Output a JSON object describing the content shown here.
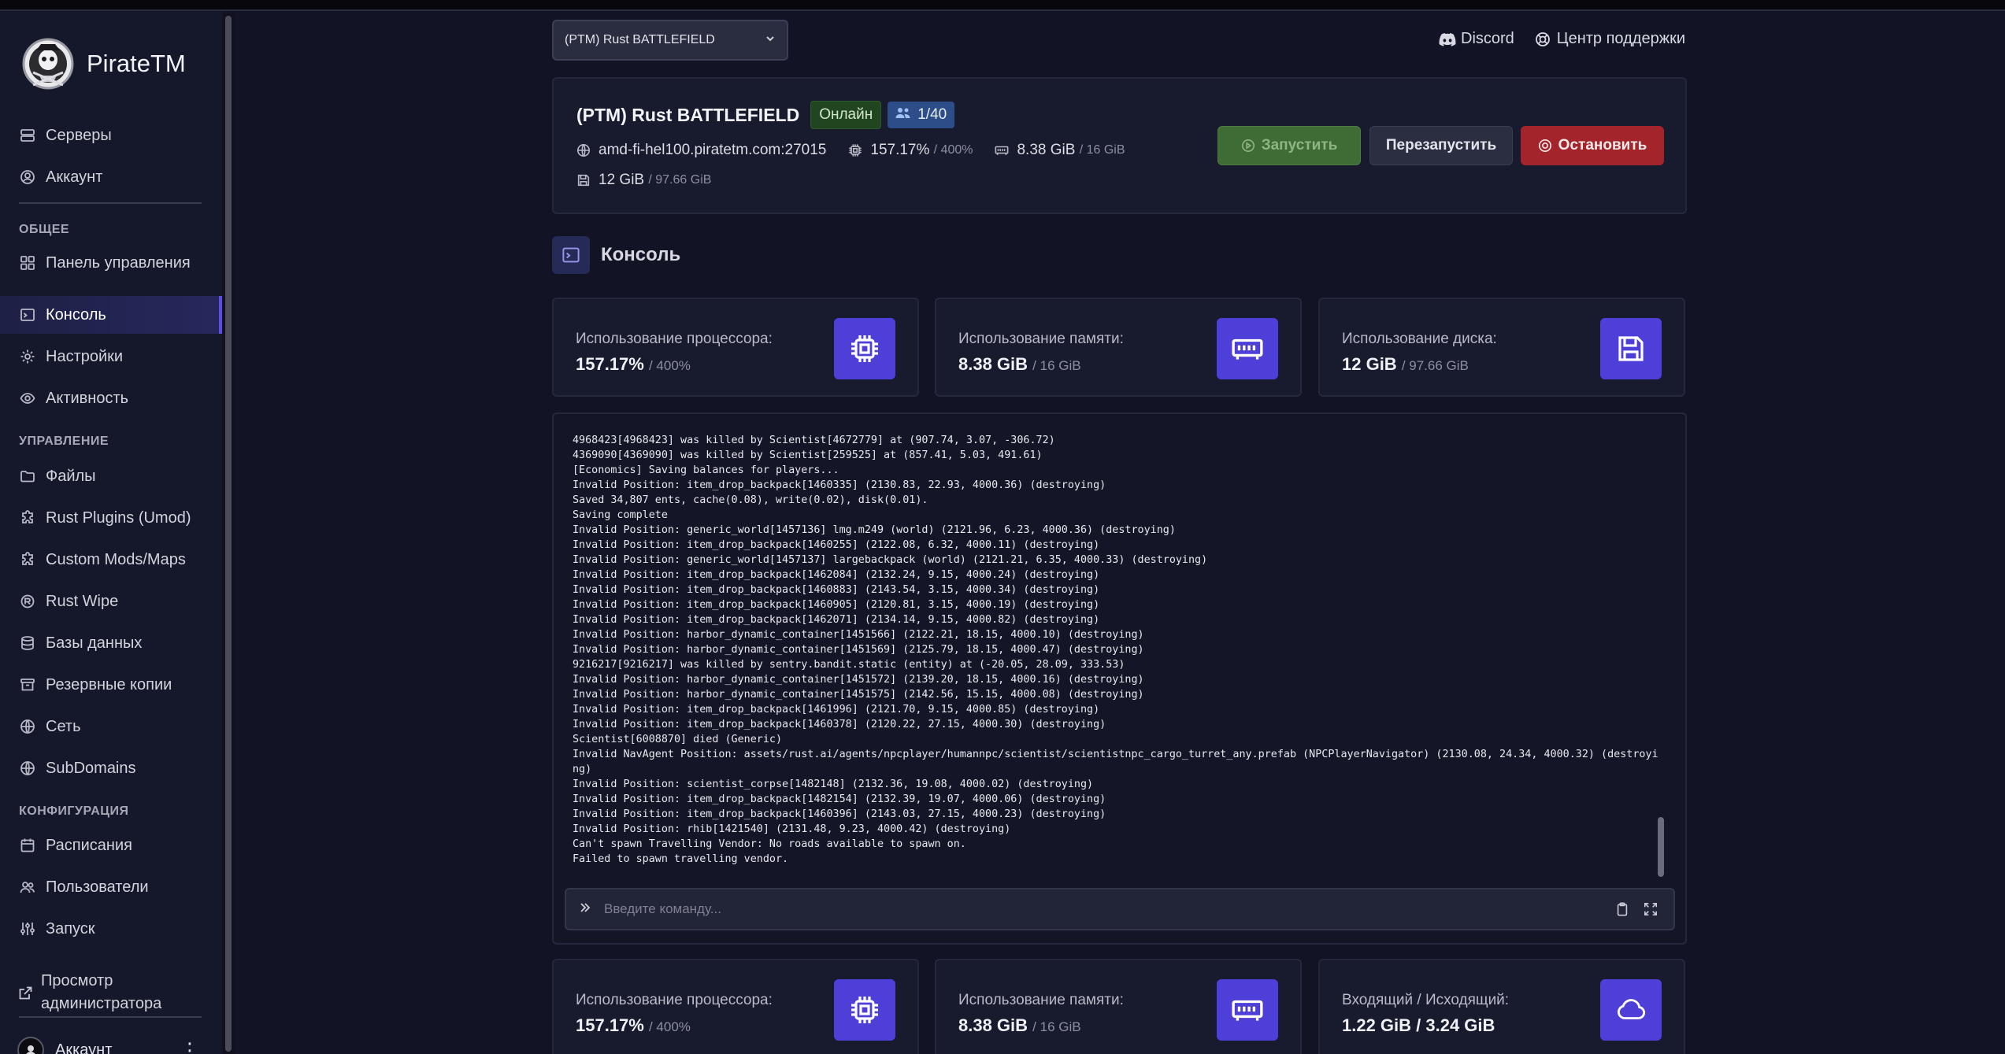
{
  "brand": {
    "name": "PirateTM"
  },
  "sidebar": {
    "top_items": [
      {
        "label": "Серверы",
        "icon": "servers-icon"
      },
      {
        "label": "Аккаунт",
        "icon": "account-icon"
      }
    ],
    "sections": [
      {
        "title": "ОБЩЕЕ",
        "items": [
          {
            "label": "Панель управления",
            "icon": "dashboard-icon"
          },
          {
            "label": "Консоль",
            "icon": "terminal-icon",
            "active": true
          },
          {
            "label": "Настройки",
            "icon": "gear-icon"
          },
          {
            "label": "Активность",
            "icon": "eye-icon"
          }
        ]
      },
      {
        "title": "УПРАВЛЕНИЕ",
        "items": [
          {
            "label": "Файлы",
            "icon": "folder-icon"
          },
          {
            "label": "Rust Plugins (Umod)",
            "icon": "puzzle-icon"
          },
          {
            "label": "Custom Mods/Maps",
            "icon": "puzzle-icon"
          },
          {
            "label": "Rust Wipe",
            "icon": "rust-icon"
          },
          {
            "label": "Базы данных",
            "icon": "database-icon"
          },
          {
            "label": "Резервные копии",
            "icon": "archive-icon"
          },
          {
            "label": "Сеть",
            "icon": "network-icon"
          },
          {
            "label": "SubDomains",
            "icon": "globe-icon"
          }
        ]
      },
      {
        "title": "КОНФИГУРАЦИЯ",
        "items": [
          {
            "label": "Расписания",
            "icon": "calendar-icon"
          },
          {
            "label": "Пользователи",
            "icon": "users-icon"
          },
          {
            "label": "Запуск",
            "icon": "sliders-icon"
          }
        ]
      }
    ],
    "admin_view": "Просмотр администратора",
    "account_label": "Аккаунт"
  },
  "header": {
    "server_select": "(PTM) Rust BATTLEFIELD",
    "discord": "Discord",
    "support": "Центр поддержки"
  },
  "server": {
    "name": "(PTM) Rust BATTLEFIELD",
    "status": "Онлайн",
    "players": "1/40",
    "address": "amd-fi-hel100.piratetm.com:27015",
    "cpu": "157.17%",
    "cpu_limit": "/ 400%",
    "memory": "8.38 GiB",
    "memory_limit": "/ 16 GiB",
    "disk": "12 GiB",
    "disk_limit": "/ 97.66 GiB",
    "btn_start": "Запустить",
    "btn_restart": "Перезапустить",
    "btn_stop": "Остановить",
    "status_color": "#21451f",
    "stop_color": "#a3242b"
  },
  "console_title": "Консоль",
  "stats_top": [
    {
      "label": "Использование процессора:",
      "value": "157.17%",
      "limit": "/ 400%",
      "icon": "cpu-icon"
    },
    {
      "label": "Использование памяти:",
      "value": "8.38 GiB",
      "limit": "/ 16 GiB",
      "icon": "memory-icon"
    },
    {
      "label": "Использование диска:",
      "value": "12 GiB",
      "limit": "/ 97.66 GiB",
      "icon": "save-icon"
    }
  ],
  "stats_bottom": [
    {
      "label": "Использование процессора:",
      "value": "157.17%",
      "limit": "/ 400%",
      "icon": "cpu-icon"
    },
    {
      "label": "Использование памяти:",
      "value": "8.38 GiB",
      "limit": "/ 16 GiB",
      "icon": "memory-icon"
    },
    {
      "label": "Входящий / Исходящий:",
      "value": "1.22 GiB / 3.24 GiB",
      "limit": "",
      "icon": "cloud-icon"
    }
  ],
  "console_log": [
    "4968423[4968423] was killed by Scientist[4672779] at (907.74, 3.07, -306.72)",
    "4369090[4369090] was killed by Scientist[259525] at (857.41, 5.03, 491.61)",
    "[Economics] Saving balances for players...",
    "Invalid Position: item_drop_backpack[1460335] (2130.83, 22.93, 4000.36) (destroying)",
    "Saved 34,807 ents, cache(0.08), write(0.02), disk(0.01).",
    "Saving complete",
    "Invalid Position: generic_world[1457136] lmg.m249 (world) (2121.96, 6.23, 4000.36) (destroying)",
    "Invalid Position: item_drop_backpack[1460255] (2122.08, 6.32, 4000.11) (destroying)",
    "Invalid Position: generic_world[1457137] largebackpack (world) (2121.21, 6.35, 4000.33) (destroying)",
    "Invalid Position: item_drop_backpack[1462084] (2132.24, 9.15, 4000.24) (destroying)",
    "Invalid Position: item_drop_backpack[1460883] (2143.54, 3.15, 4000.34) (destroying)",
    "Invalid Position: item_drop_backpack[1460905] (2120.81, 3.15, 4000.19) (destroying)",
    "Invalid Position: item_drop_backpack[1462071] (2134.14, 9.15, 4000.82) (destroying)",
    "Invalid Position: harbor_dynamic_container[1451566] (2122.21, 18.15, 4000.10) (destroying)",
    "Invalid Position: harbor_dynamic_container[1451569] (2125.79, 18.15, 4000.47) (destroying)",
    "9216217[9216217] was killed by sentry.bandit.static (entity) at (-20.05, 28.09, 333.53)",
    "Invalid Position: harbor_dynamic_container[1451572] (2139.20, 18.15, 4000.16) (destroying)",
    "Invalid Position: harbor_dynamic_container[1451575] (2142.56, 15.15, 4000.08) (destroying)",
    "Invalid Position: item_drop_backpack[1461996] (2121.70, 9.15, 4000.85) (destroying)",
    "Invalid Position: item_drop_backpack[1460378] (2120.22, 27.15, 4000.30) (destroying)",
    "Scientist[6008870] died (Generic)",
    "Invalid NavAgent Position: assets/rust.ai/agents/npcplayer/humannpc/scientist/scientistnpc_cargo_turret_any.prefab (NPCPlayerNavigator) (2130.08, 24.34, 4000.32) (destroyi",
    "ng)",
    "Invalid Position: scientist_corpse[1482148] (2132.36, 19.08, 4000.02) (destroying)",
    "Invalid Position: item_drop_backpack[1482154] (2132.39, 19.07, 4000.06) (destroying)",
    "Invalid Position: item_drop_backpack[1460396] (2143.03, 27.15, 4000.23) (destroying)",
    "Invalid Position: rhib[1421540] (2131.48, 9.23, 4000.42) (destroying)",
    "Can't spawn Travelling Vendor: No roads available to spawn on.",
    "Failed to spawn travelling vendor."
  ],
  "command": {
    "placeholder": "Введите команду...",
    "value": ""
  },
  "accent_color": "#4d3fd8"
}
